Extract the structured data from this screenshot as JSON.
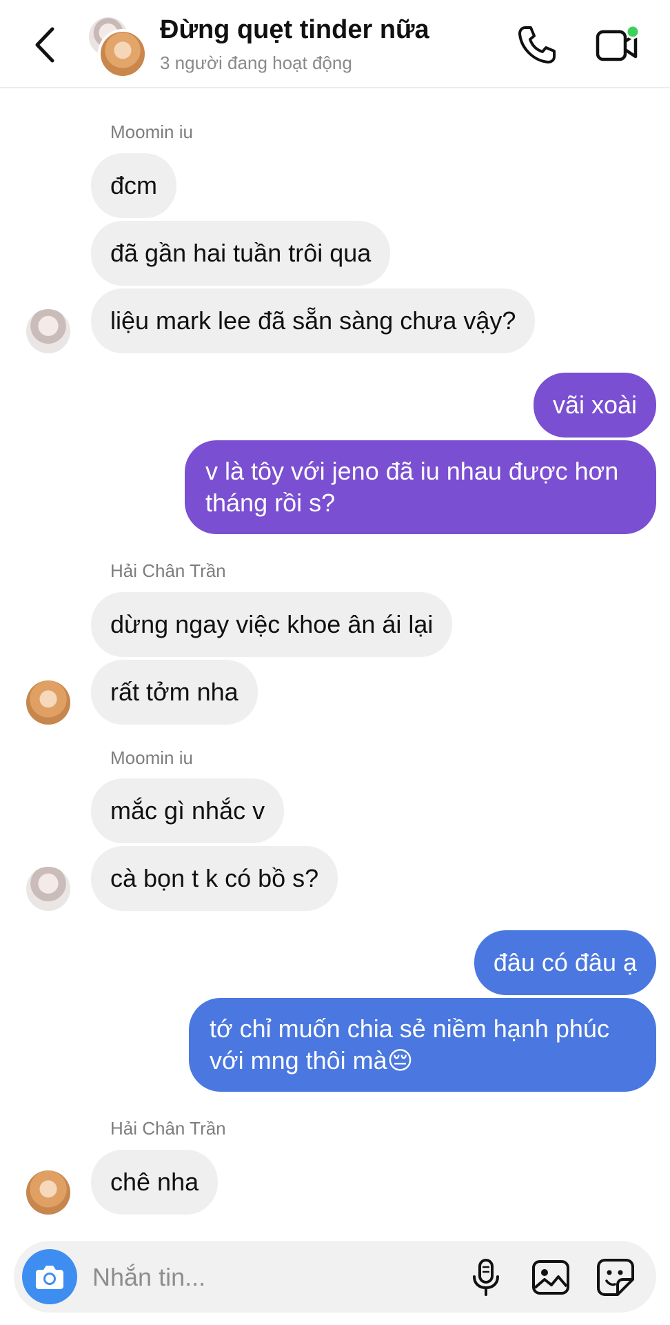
{
  "header": {
    "title": "Đừng quẹt tinder nữa",
    "subtitle": "3 người đang hoạt động",
    "online_color": "#3dd15c"
  },
  "messages": [
    {
      "type": "name",
      "text": "Moomin iu"
    },
    {
      "type": "in",
      "sender": "Moomin iu",
      "text": "đcm"
    },
    {
      "type": "in",
      "sender": "Moomin iu",
      "text": "đã gần hai tuần trôi qua"
    },
    {
      "type": "in",
      "sender": "Moomin iu",
      "text": "liệu mark lee đã sẵn sàng chưa vậy?"
    },
    {
      "type": "out",
      "color": "#7a4fd1",
      "text": "vãi xoài"
    },
    {
      "type": "out",
      "color": "#7a4fd1",
      "text": "v là tôy với jeno đã iu nhau được hơn tháng rồi s?"
    },
    {
      "type": "name",
      "text": "Hải Chân Trần"
    },
    {
      "type": "in",
      "sender": "Hải Chân Trần",
      "text": "dừng ngay việc khoe ân ái lại"
    },
    {
      "type": "in",
      "sender": "Hải Chân Trần",
      "text": "rất tởm nha"
    },
    {
      "type": "name",
      "text": "Moomin iu"
    },
    {
      "type": "in",
      "sender": "Moomin iu",
      "text": "mắc gì nhắc v"
    },
    {
      "type": "in",
      "sender": "Moomin iu",
      "text": "cà bọn t k có bồ s?"
    },
    {
      "type": "out",
      "color": "#4a78e0",
      "text": "đâu có đâu ạ"
    },
    {
      "type": "out",
      "color": "#4a78e0",
      "text": "tớ chỉ muốn chia sẻ niềm hạnh phúc với mng thôi mà😔"
    },
    {
      "type": "name",
      "text": "Hải Chân Trần"
    },
    {
      "type": "in",
      "sender": "Hải Chân Trần",
      "text": "chê nha"
    }
  ],
  "composer": {
    "placeholder": "Nhắn tin...",
    "icons": [
      "camera-icon",
      "microphone-icon",
      "image-icon",
      "sticker-icon"
    ],
    "camera_color": "#3d8ef0"
  },
  "colors": {
    "bubble_in": "#efefef",
    "bubble_out_purple": "#7a4fd1",
    "bubble_out_blue": "#4a78e0"
  }
}
